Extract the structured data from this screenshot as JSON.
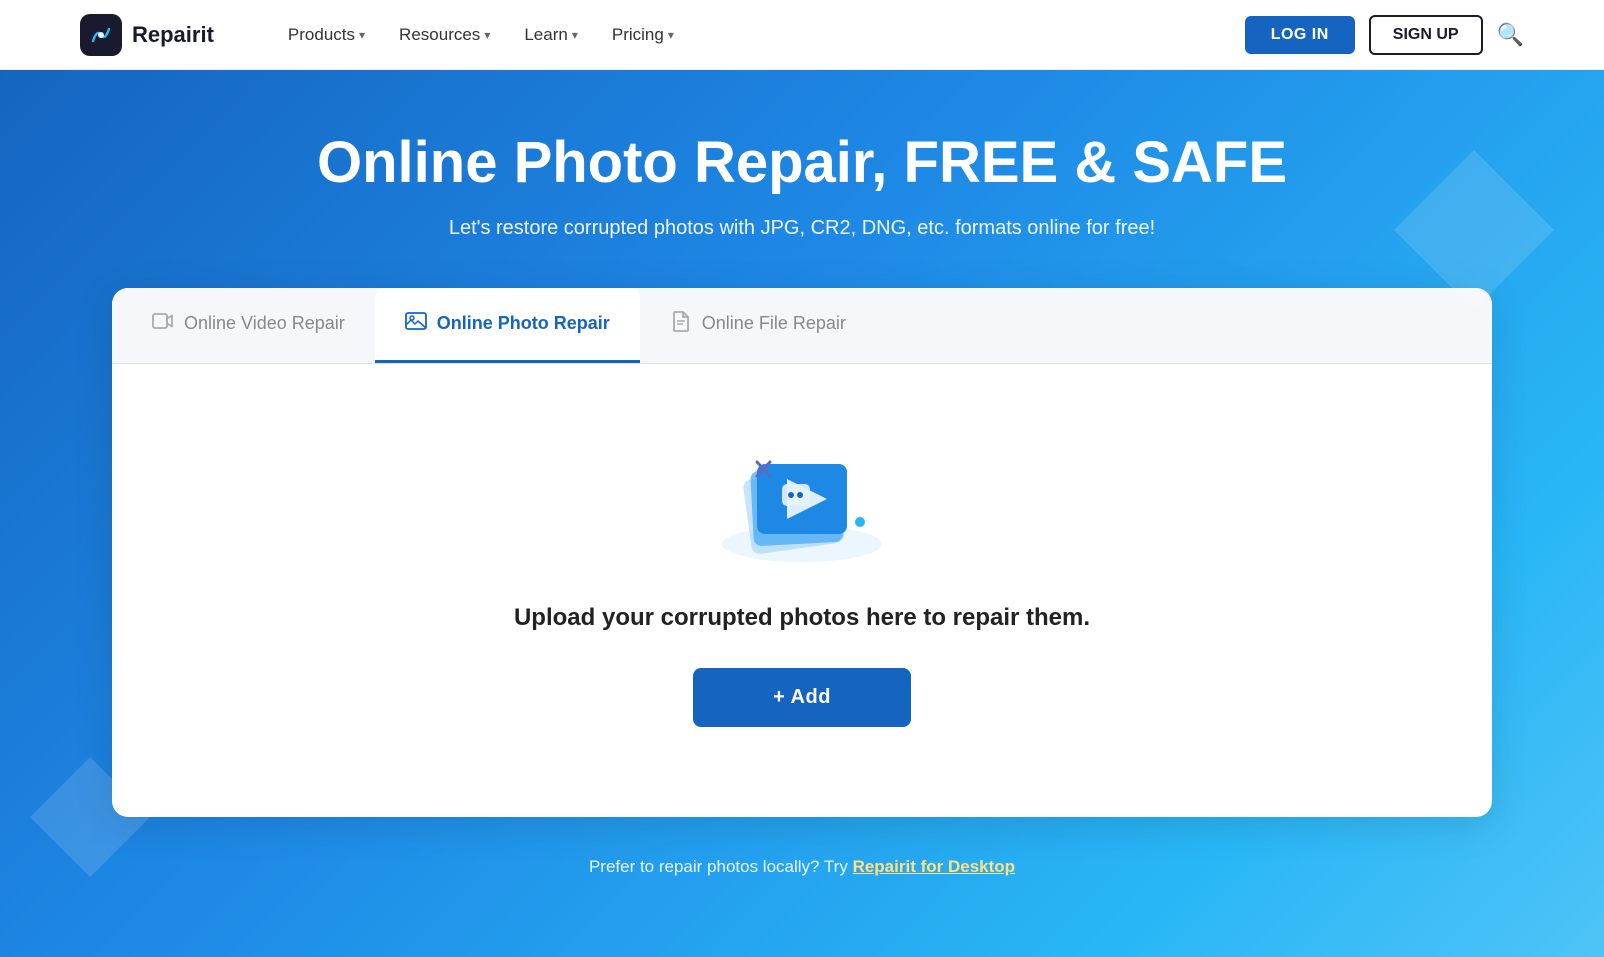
{
  "navbar": {
    "logo_name": "Repairit",
    "nav_items": [
      {
        "label": "Products",
        "has_dropdown": true
      },
      {
        "label": "Resources",
        "has_dropdown": true
      },
      {
        "label": "Learn",
        "has_dropdown": true
      },
      {
        "label": "Pricing",
        "has_dropdown": true
      }
    ],
    "btn_login": "LOG IN",
    "btn_signup": "SIGN UP"
  },
  "hero": {
    "title": "Online Photo Repair, FREE & SAFE",
    "subtitle": "Let's restore corrupted photos with JPG, CR2, DNG, etc. formats online for free!"
  },
  "tabs": [
    {
      "label": "Online Video Repair",
      "icon": "🎬",
      "active": false
    },
    {
      "label": "Online Photo Repair",
      "icon": "🖼️",
      "active": true
    },
    {
      "label": "Online File Repair",
      "icon": "📄",
      "active": false
    }
  ],
  "upload": {
    "text": "Upload your corrupted photos here to repair them.",
    "btn_label": "+ Add"
  },
  "bottom_note": {
    "text": "Prefer to repair photos locally? Try ",
    "link_text": "Repairit for Desktop"
  }
}
